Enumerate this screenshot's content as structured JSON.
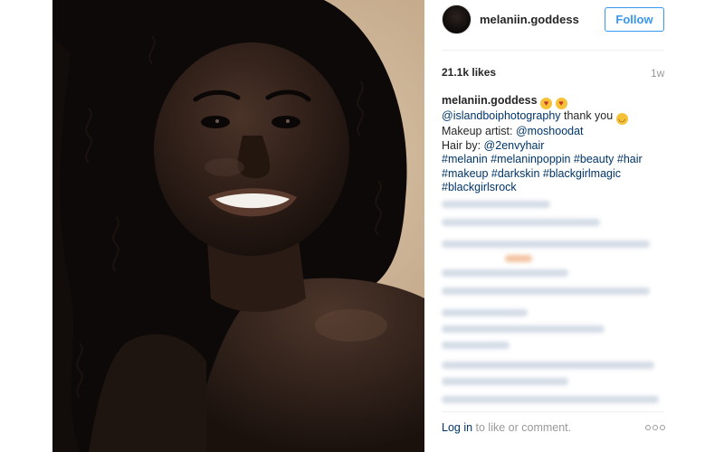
{
  "post": {
    "username": "melaniin.goddess",
    "follow_label": "Follow",
    "likes": "21.1k likes",
    "time": "1w",
    "caption": {
      "author": "melaniin.goddess",
      "line1_mention": "@islandboiphotography",
      "line1_text": " thank you ",
      "line2_label": "Makeup artist: ",
      "line2_mention": "@moshoodat",
      "line3_label": "Hair by: ",
      "line3_mention": "@2envyhair",
      "hashtags_line1": "#melanin #melaninpoppin #beauty #hair",
      "hashtags_line2": "#makeup #darkskin #blackgirlmagic",
      "hashtags_line3": "#blackgirlsrock"
    },
    "footer": {
      "login_link": "Log in",
      "footer_text": " to like or comment."
    },
    "icons": {
      "emoji": "heart-eyes-emoji",
      "wink": "wink-emoji",
      "more": "more-icon"
    },
    "colors": {
      "link": "#003569",
      "follow": "#3897f0",
      "background": "#ffffff"
    }
  }
}
